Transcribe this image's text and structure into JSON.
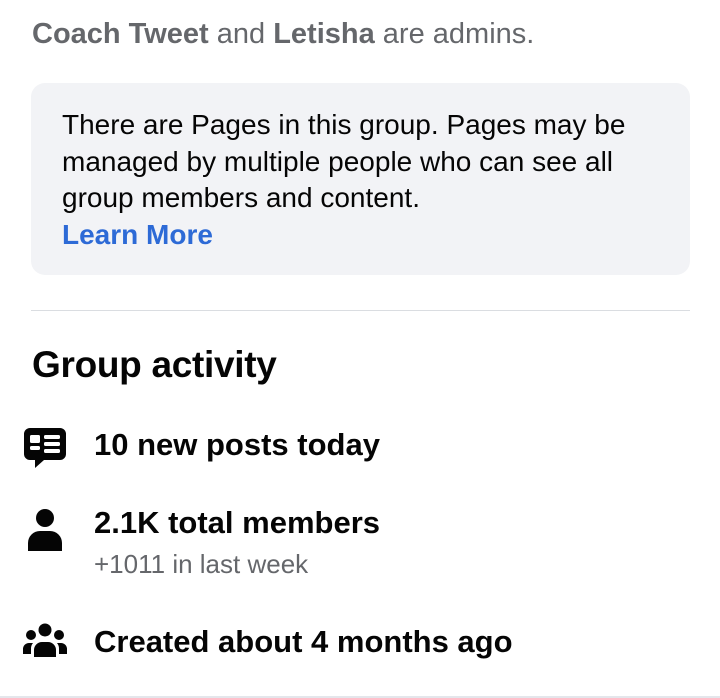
{
  "admins": {
    "name1": "Coach Tweet",
    "connector": " and ",
    "name2": "Letisha",
    "suffix": " are admins."
  },
  "notice": {
    "text": "There are Pages in this group. Pages may be managed by multiple people who can see all group members and content.",
    "link_label": "Learn More"
  },
  "activity": {
    "title": "Group activity",
    "posts": {
      "label": "10 new posts today",
      "icon": "posts-icon"
    },
    "members": {
      "label": "2.1K total members",
      "sublabel": "+1011 in last week",
      "icon": "person-icon"
    },
    "created": {
      "label": "Created about 4 months ago",
      "icon": "group-icon"
    }
  },
  "colors": {
    "link": "#2d6ad6",
    "secondary_text": "#65676b",
    "notice_bg": "#f2f3f6"
  }
}
